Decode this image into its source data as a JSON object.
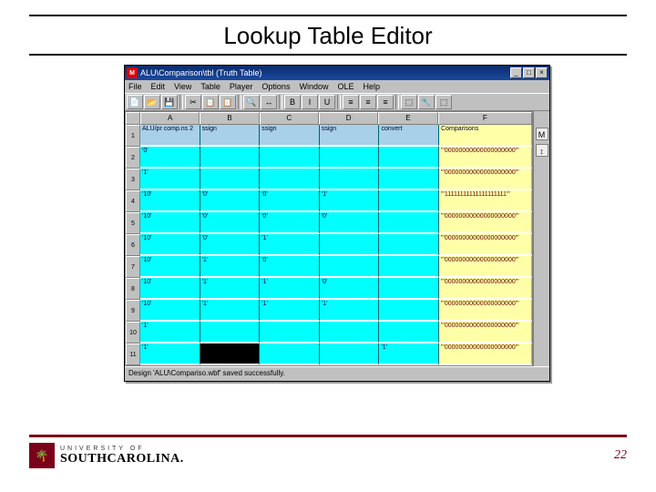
{
  "slide": {
    "title": "Lookup Table Editor",
    "page_number": "22"
  },
  "footer_logo": {
    "line1": "UNIVERSITY OF",
    "line2": "SOUTHCAROLINA."
  },
  "window": {
    "title": "ALU\\Comparison\\tbl (Truth Table)",
    "app_icon_label": "M",
    "controls": {
      "min": "_",
      "max": "□",
      "close": "×"
    },
    "menus": [
      "File",
      "Edit",
      "View",
      "Table",
      "Player",
      "Options",
      "Window",
      "OLE",
      "Help"
    ],
    "toolbar_icons": [
      "📄",
      "📂",
      "💾",
      "|",
      "✂",
      "📋",
      "📋",
      "|",
      "🔍",
      "↔",
      "|",
      "B",
      "I",
      "U",
      "|",
      "≡",
      "≡",
      "≡",
      "|",
      "⬚",
      "🔧",
      "⬚"
    ],
    "side_icons": [
      "M",
      "↕"
    ],
    "status": "Design 'ALU\\Compariso.wbf' saved successfully.",
    "col_headers": [
      "",
      "A",
      "B",
      "C",
      "D",
      "E",
      "F"
    ],
    "rows": [
      {
        "n": "1",
        "header": true,
        "cells": [
          "ALU/pr comp.ns 2",
          "ssign",
          "ssign",
          "ssign",
          "convert",
          "Comparisons"
        ]
      },
      {
        "n": "2",
        "cells": [
          "'0'",
          "",
          "",
          "",
          "",
          "\"'00000000000000000000'\""
        ]
      },
      {
        "n": "3",
        "cells": [
          "'1'",
          "",
          "",
          "",
          "",
          "\"'00000000000000000000'\""
        ]
      },
      {
        "n": "4",
        "cells": [
          "'10'",
          "'0'",
          "'0'",
          "'1'",
          "",
          "\"'11111111111111111111'\""
        ]
      },
      {
        "n": "5",
        "cells": [
          "'10'",
          "'0'",
          "'0'",
          "'0'",
          "",
          "\"'00000000000000000000'\""
        ]
      },
      {
        "n": "6",
        "cells": [
          "'10'",
          "'0'",
          "'1'",
          "",
          "",
          "\"'00000000000000000000'\""
        ]
      },
      {
        "n": "7",
        "cells": [
          "'10'",
          "'1'",
          "'0'",
          "",
          "",
          "\"'00000000000000000000'\""
        ]
      },
      {
        "n": "8",
        "cells": [
          "'10'",
          "'1'",
          "'1'",
          "'0'",
          "",
          "\"'00000000000000000000'\""
        ]
      },
      {
        "n": "9",
        "cells": [
          "'10'",
          "'1'",
          "'1'",
          "'1'",
          "",
          "\"'00000000000000000000'\""
        ]
      },
      {
        "n": "10",
        "cells": [
          "'1'",
          "",
          "",
          "",
          "",
          "\"'00000000000000000000'\""
        ]
      },
      {
        "n": "11",
        "cells": [
          "'1'",
          "",
          "",
          "",
          "'1'",
          "\"'00000000000000000000'\""
        ],
        "black_col": 1
      }
    ]
  }
}
